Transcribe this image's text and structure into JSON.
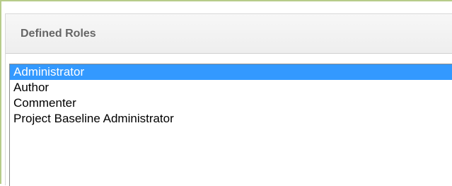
{
  "panel": {
    "title": "Defined Roles"
  },
  "roles_list": {
    "items": [
      {
        "label": "Administrator",
        "selected": true
      },
      {
        "label": "Author",
        "selected": false
      },
      {
        "label": "Commenter",
        "selected": false
      },
      {
        "label": "Project Baseline Administrator",
        "selected": false
      }
    ]
  },
  "colors": {
    "selection_background": "#3399ff",
    "selection_text": "#ffffff",
    "frame_border": "#b7cc8a",
    "header_text": "#666666"
  }
}
